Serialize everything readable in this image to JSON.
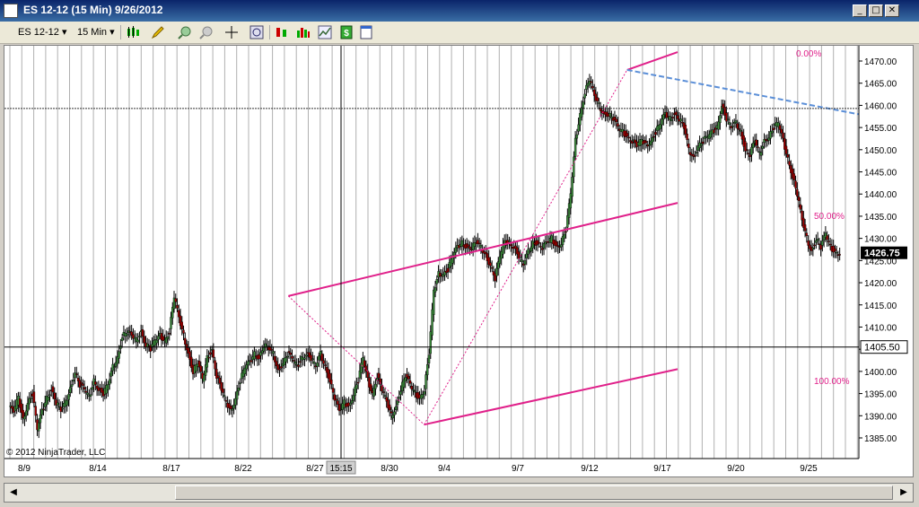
{
  "window": {
    "title": "ES 12-12 (15 Min)  9/26/2012",
    "minimize_glyph": "_",
    "restore_glyph": "□",
    "close_glyph": "✕"
  },
  "toolbar": {
    "instrument": "ES 12-12",
    "interval": "15 Min",
    "icons": [
      "candlestick-icon",
      "drawing-pencil-icon",
      "zoom-in-icon",
      "zoom-out-icon",
      "crosshair-icon",
      "magnifier-icon",
      "strategy-icon",
      "indicator-icon",
      "chart-icon",
      "currency-icon",
      "properties-icon"
    ]
  },
  "chart_data": {
    "type": "candlestick",
    "price_axis": {
      "labels": [
        "1470.00",
        "1465.00",
        "1460.00",
        "1455.00",
        "1450.00",
        "1445.00",
        "1440.00",
        "1435.00",
        "1430.00",
        "1425.00",
        "1420.00",
        "1415.00",
        "1410.00",
        "1405.00",
        "1400.00",
        "1395.00",
        "1390.00",
        "1385.00"
      ],
      "min": 1384,
      "max": 1473
    },
    "date_labels": [
      "8/9",
      "8/14",
      "8/17",
      "8/22",
      "8/27",
      "8/30",
      "9/4",
      "9/7",
      "9/12",
      "9/17",
      "9/20",
      "9/25"
    ],
    "current_price": "1426.75",
    "crosshair_price": "1405.50",
    "crosshair_time": "15:15",
    "copyright": "© 2012 NinjaTrader, LLC",
    "fib_labels": {
      "top": "0.00%",
      "mid": "50.00%",
      "bottom": "100.00%"
    },
    "price_path": [
      [
        0,
        1392
      ],
      [
        4,
        1391
      ],
      [
        8,
        1394
      ],
      [
        12,
        1389
      ],
      [
        16,
        1393
      ],
      [
        20,
        1395
      ],
      [
        24,
        1387
      ],
      [
        28,
        1391
      ],
      [
        32,
        1394
      ],
      [
        36,
        1396
      ],
      [
        40,
        1393
      ],
      [
        44,
        1391
      ],
      [
        48,
        1393
      ],
      [
        52,
        1396
      ],
      [
        56,
        1400
      ],
      [
        60,
        1397
      ],
      [
        64,
        1396
      ],
      [
        68,
        1394
      ],
      [
        72,
        1398
      ],
      [
        76,
        1396
      ],
      [
        80,
        1395
      ],
      [
        84,
        1397
      ],
      [
        88,
        1401
      ],
      [
        92,
        1403
      ],
      [
        96,
        1408
      ],
      [
        100,
        1409
      ],
      [
        104,
        1408
      ],
      [
        108,
        1407
      ],
      [
        112,
        1409
      ],
      [
        116,
        1406
      ],
      [
        120,
        1405
      ],
      [
        124,
        1407
      ],
      [
        128,
        1408
      ],
      [
        132,
        1407
      ],
      [
        136,
        1409
      ],
      [
        140,
        1417
      ],
      [
        144,
        1412
      ],
      [
        148,
        1408
      ],
      [
        152,
        1404
      ],
      [
        156,
        1400
      ],
      [
        160,
        1402
      ],
      [
        164,
        1398
      ],
      [
        168,
        1403
      ],
      [
        172,
        1405
      ],
      [
        176,
        1399
      ],
      [
        180,
        1396
      ],
      [
        184,
        1393
      ],
      [
        188,
        1391
      ],
      [
        192,
        1394
      ],
      [
        196,
        1398
      ],
      [
        200,
        1401
      ],
      [
        204,
        1402
      ],
      [
        208,
        1404
      ],
      [
        212,
        1403
      ],
      [
        216,
        1406
      ],
      [
        220,
        1405
      ],
      [
        224,
        1404
      ],
      [
        228,
        1400
      ],
      [
        232,
        1402
      ],
      [
        236,
        1404
      ],
      [
        240,
        1403
      ],
      [
        244,
        1401
      ],
      [
        248,
        1403
      ],
      [
        252,
        1404
      ],
      [
        256,
        1403
      ],
      [
        260,
        1401
      ],
      [
        264,
        1404
      ],
      [
        268,
        1401
      ],
      [
        272,
        1398
      ],
      [
        276,
        1394
      ],
      [
        280,
        1391
      ],
      [
        284,
        1393
      ],
      [
        288,
        1392
      ],
      [
        292,
        1395
      ],
      [
        296,
        1398
      ],
      [
        300,
        1403
      ],
      [
        304,
        1398
      ],
      [
        308,
        1395
      ],
      [
        312,
        1399
      ],
      [
        316,
        1396
      ],
      [
        320,
        1393
      ],
      [
        324,
        1390
      ],
      [
        328,
        1392
      ],
      [
        332,
        1396
      ],
      [
        336,
        1399
      ],
      [
        340,
        1397
      ],
      [
        344,
        1395
      ],
      [
        348,
        1394
      ],
      [
        352,
        1396
      ],
      [
        356,
        1404
      ],
      [
        360,
        1418
      ],
      [
        364,
        1422
      ],
      [
        368,
        1422
      ],
      [
        372,
        1423
      ],
      [
        376,
        1426
      ],
      [
        380,
        1428
      ],
      [
        384,
        1429
      ],
      [
        388,
        1428
      ],
      [
        392,
        1428
      ],
      [
        396,
        1429
      ],
      [
        400,
        1428
      ],
      [
        404,
        1426
      ],
      [
        408,
        1424
      ],
      [
        412,
        1421
      ],
      [
        416,
        1426
      ],
      [
        420,
        1429
      ],
      [
        424,
        1429
      ],
      [
        428,
        1428
      ],
      [
        432,
        1426
      ],
      [
        436,
        1424
      ],
      [
        440,
        1427
      ],
      [
        444,
        1429
      ],
      [
        448,
        1429
      ],
      [
        452,
        1428
      ],
      [
        456,
        1429
      ],
      [
        460,
        1430
      ],
      [
        464,
        1428
      ],
      [
        468,
        1429
      ],
      [
        472,
        1432
      ],
      [
        476,
        1440
      ],
      [
        480,
        1452
      ],
      [
        484,
        1458
      ],
      [
        488,
        1463
      ],
      [
        492,
        1466
      ],
      [
        496,
        1462
      ],
      [
        500,
        1460
      ],
      [
        504,
        1458
      ],
      [
        508,
        1458
      ],
      [
        512,
        1457
      ],
      [
        516,
        1455
      ],
      [
        520,
        1454
      ],
      [
        524,
        1453
      ],
      [
        528,
        1452
      ],
      [
        532,
        1451
      ],
      [
        536,
        1452
      ],
      [
        540,
        1451
      ],
      [
        544,
        1452
      ],
      [
        548,
        1454
      ],
      [
        552,
        1456
      ],
      [
        556,
        1458
      ],
      [
        560,
        1457
      ],
      [
        564,
        1458
      ],
      [
        568,
        1457
      ],
      [
        572,
        1455
      ],
      [
        576,
        1450
      ],
      [
        580,
        1448
      ],
      [
        584,
        1451
      ],
      [
        588,
        1452
      ],
      [
        592,
        1453
      ],
      [
        596,
        1454
      ],
      [
        600,
        1455
      ],
      [
        604,
        1460
      ],
      [
        608,
        1457
      ],
      [
        612,
        1455
      ],
      [
        616,
        1456
      ],
      [
        620,
        1454
      ],
      [
        624,
        1450
      ],
      [
        628,
        1449
      ],
      [
        632,
        1452
      ],
      [
        636,
        1449
      ],
      [
        640,
        1452
      ],
      [
        644,
        1453
      ],
      [
        648,
        1455
      ],
      [
        652,
        1456
      ],
      [
        656,
        1452
      ],
      [
        660,
        1448
      ],
      [
        664,
        1444
      ],
      [
        668,
        1440
      ],
      [
        672,
        1434
      ],
      [
        676,
        1430
      ],
      [
        680,
        1427
      ],
      [
        684,
        1430
      ],
      [
        688,
        1428
      ],
      [
        692,
        1431
      ],
      [
        696,
        1428
      ],
      [
        700,
        1427
      ],
      [
        704,
        1426.75
      ]
    ],
    "fib": {
      "retrace_start": [
        236,
        1417
      ],
      "retrace_low": [
        351,
        1388
      ],
      "trend_high": [
        523,
        1468
      ],
      "channel_right": 750,
      "upper_right": 1472,
      "mid_right": 1438,
      "lower_right": 1400.5
    },
    "trendline": {
      "from": [
        523,
        1468
      ],
      "to": [
        719,
        1458
      ]
    }
  }
}
